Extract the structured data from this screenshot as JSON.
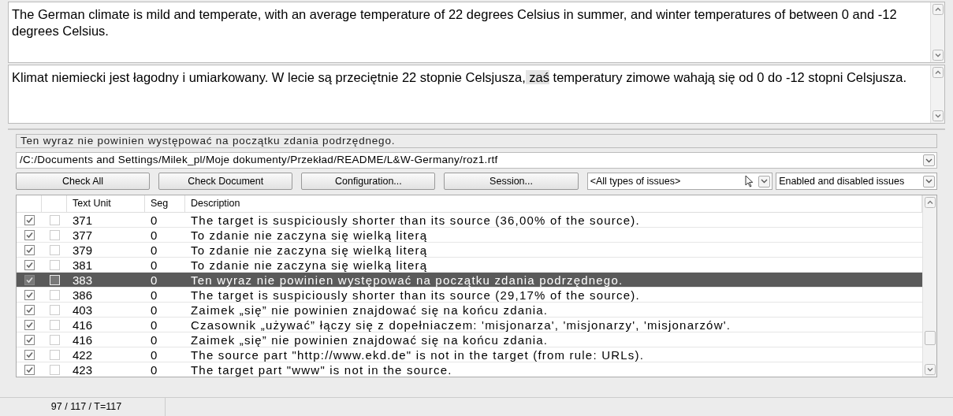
{
  "source_text": "The German climate is mild and temperate, with an average temperature of 22 degrees Celsius in summer, and winter temperatures of between 0 and -12 degrees Celsius.",
  "target_text": [
    {
      "text": "Klimat niemiecki jest łagodny i umiarkowany. W lecie są przeciętnie 22 stopnie Celsjusza,",
      "highlighted": false
    },
    {
      "text": " zaś",
      "highlighted": true
    },
    {
      "text": " temperatury zimowe wahają się od 0 do -12 stopni Celsjusza.",
      "highlighted": false
    }
  ],
  "message": "Ten wyraz nie powinien występować na początku zdania podrzędnego.",
  "file_path": "/C:/Documents and Settings/Milek_pl/Moje dokumenty/Przekład/README/L&W-Germany/roz1.rtf",
  "buttons": [
    "Check All",
    "Check Document",
    "Configuration...",
    "Session..."
  ],
  "issue_type_filter": "<All types of issues>",
  "state_filter": "Enabled and disabled issues",
  "table": {
    "columns": [
      "Text Unit",
      "Seg",
      "Description"
    ],
    "rows": [
      {
        "enabled": true,
        "ignored": false,
        "selected": false,
        "unit": "371",
        "seg": "0",
        "description": "The target is suspiciously shorter than its source (36,00% of the source)."
      },
      {
        "enabled": true,
        "ignored": false,
        "selected": false,
        "unit": "377",
        "seg": "0",
        "description": "To zdanie nie zaczyna się wielką literą"
      },
      {
        "enabled": true,
        "ignored": false,
        "selected": false,
        "unit": "379",
        "seg": "0",
        "description": "To zdanie nie zaczyna się wielką literą"
      },
      {
        "enabled": true,
        "ignored": false,
        "selected": false,
        "unit": "381",
        "seg": "0",
        "description": "To zdanie nie zaczyna się wielką literą"
      },
      {
        "enabled": true,
        "ignored": false,
        "selected": true,
        "unit": "383",
        "seg": "0",
        "description": "Ten wyraz nie powinien występować na początku zdania podrzędnego."
      },
      {
        "enabled": true,
        "ignored": false,
        "selected": false,
        "unit": "386",
        "seg": "0",
        "description": "The target is suspiciously shorter than its source (29,17% of the source)."
      },
      {
        "enabled": true,
        "ignored": false,
        "selected": false,
        "unit": "403",
        "seg": "0",
        "description": "Zaimek „się” nie powinien znajdować się na końcu zdania."
      },
      {
        "enabled": true,
        "ignored": false,
        "selected": false,
        "unit": "416",
        "seg": "0",
        "description": "Czasownik „używać” łączy się z dopełniaczem: 'misjonarza', 'misjonarzy', 'misjonarzów'."
      },
      {
        "enabled": true,
        "ignored": false,
        "selected": false,
        "unit": "416",
        "seg": "0",
        "description": "Zaimek „się” nie powinien znajdować się na końcu zdania."
      },
      {
        "enabled": true,
        "ignored": false,
        "selected": false,
        "unit": "422",
        "seg": "0",
        "description": "The source part \"http://www.ekd.de\" is not in the target (from rule: URLs)."
      },
      {
        "enabled": true,
        "ignored": false,
        "selected": false,
        "unit": "423",
        "seg": "0",
        "description": "The target part \"www\" is not in the source."
      }
    ]
  },
  "status": "97 / 117 / T=117"
}
